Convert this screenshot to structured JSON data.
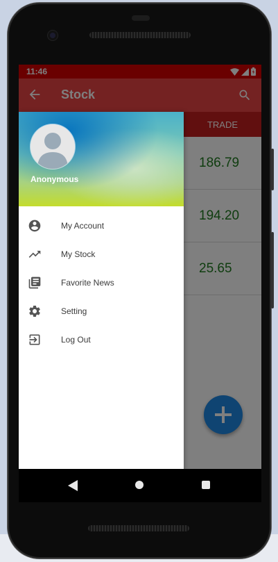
{
  "status_bar": {
    "time": "11:46"
  },
  "app_bar": {
    "title": "Stock"
  },
  "content": {
    "column_header": "TRADE",
    "trade_values": [
      "186.79",
      "194.20",
      "25.65"
    ]
  },
  "drawer": {
    "username": "Anonymous",
    "items": [
      {
        "label": "My Account",
        "icon": "account-circle-icon"
      },
      {
        "label": "My Stock",
        "icon": "trending-up-icon"
      },
      {
        "label": "Favorite News",
        "icon": "news-icon"
      },
      {
        "label": "Setting",
        "icon": "gear-icon"
      },
      {
        "label": "Log Out",
        "icon": "logout-icon"
      }
    ]
  },
  "colors": {
    "status_bar": "#d50000",
    "app_bar": "#e84545",
    "column_header": "#c21e1e",
    "value_text": "#1f7a1f",
    "fab": "#1e88e5"
  }
}
